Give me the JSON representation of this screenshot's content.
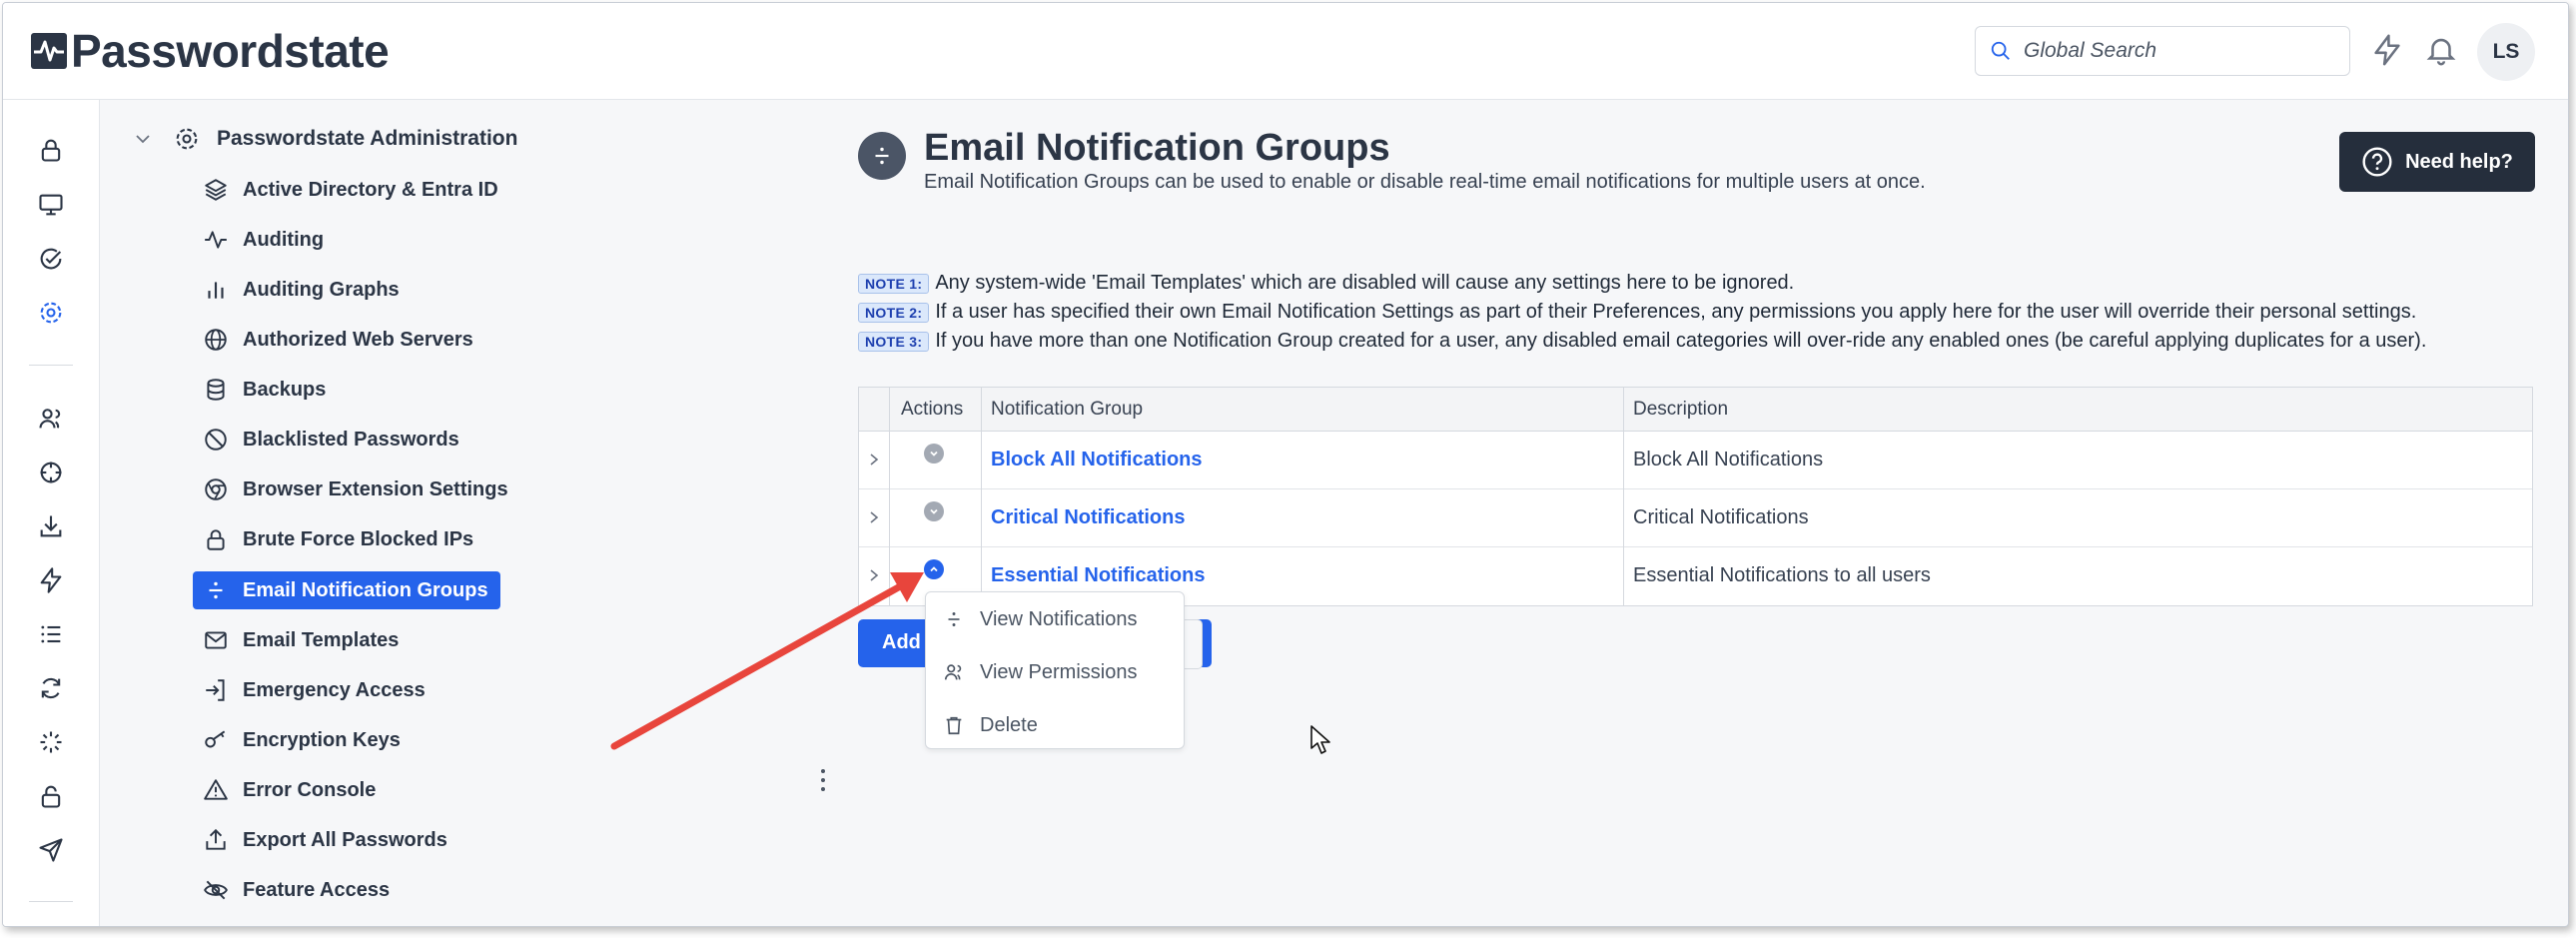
{
  "app": {
    "name": "Passwordstate"
  },
  "header": {
    "search_placeholder": "Global Search",
    "user_initials": "LS",
    "icons": [
      "lightning-icon",
      "bell-icon"
    ]
  },
  "rail": {
    "icons": [
      "lock-icon",
      "monitor-icon",
      "check-circle-icon",
      "gear-icon",
      "users-icon",
      "crosshair-icon",
      "download-icon",
      "lightning-icon",
      "list-icon",
      "sync-icon",
      "loader-icon",
      "unlock-icon",
      "send-icon"
    ],
    "active": "gear-icon",
    "accent": "#2563eb"
  },
  "nav": {
    "root_label": "Passwordstate Administration",
    "items": [
      {
        "label": "Active Directory & Entra ID",
        "icon": "layers-icon"
      },
      {
        "label": "Auditing",
        "icon": "activity-icon"
      },
      {
        "label": "Auditing Graphs",
        "icon": "bar-chart-icon"
      },
      {
        "label": "Authorized Web Servers",
        "icon": "globe-icon"
      },
      {
        "label": "Backups",
        "icon": "database-icon"
      },
      {
        "label": "Blacklisted Passwords",
        "icon": "ban-icon"
      },
      {
        "label": "Browser Extension Settings",
        "icon": "chrome-icon"
      },
      {
        "label": "Brute Force Blocked IPs",
        "icon": "lock-icon"
      },
      {
        "label": "Email Notification Groups",
        "icon": "divide-icon"
      },
      {
        "label": "Email Templates",
        "icon": "mail-icon"
      },
      {
        "label": "Emergency Access",
        "icon": "sign-in-icon"
      },
      {
        "label": "Encryption Keys",
        "icon": "key-icon"
      },
      {
        "label": "Error Console",
        "icon": "warning-icon"
      },
      {
        "label": "Export All Passwords",
        "icon": "upload-icon"
      },
      {
        "label": "Feature Access",
        "icon": "eye-off-icon"
      }
    ],
    "active_index": 8
  },
  "main": {
    "title": "Email Notification Groups",
    "subtitle": "Email Notification Groups can be used to enable or disable real-time email notifications for multiple users at once.",
    "help_label": "Need help?",
    "notes": [
      {
        "tag": "NOTE 1:",
        "text": "Any system-wide 'Email Templates' which are disabled will cause any settings here to be ignored."
      },
      {
        "tag": "NOTE 2:",
        "text": "If a user has specified their own Email Notification Settings as part of their Preferences, any permissions you apply here for the user will override their personal settings."
      },
      {
        "tag": "NOTE 3:",
        "text": "If you have more than one Notification Group created for a user, any disabled email categories will over-ride any enabled ones (be careful applying duplicates for a user)."
      }
    ],
    "table": {
      "headers": [
        "Actions",
        "Notification Group",
        "Description"
      ],
      "rows": [
        {
          "group": "Block All Notifications",
          "description": "Block All Notifications"
        },
        {
          "group": "Critical Notifications",
          "description": "Critical Notifications"
        },
        {
          "group": "Essential Notifications",
          "description": "Essential Notifications to all users"
        }
      ]
    },
    "add_button_label": "Add",
    "menu": {
      "items": [
        {
          "label": "View Notifications",
          "icon": "divide-icon"
        },
        {
          "label": "View Permissions",
          "icon": "users-icon"
        },
        {
          "label": "Delete",
          "icon": "trash-icon"
        }
      ]
    }
  }
}
